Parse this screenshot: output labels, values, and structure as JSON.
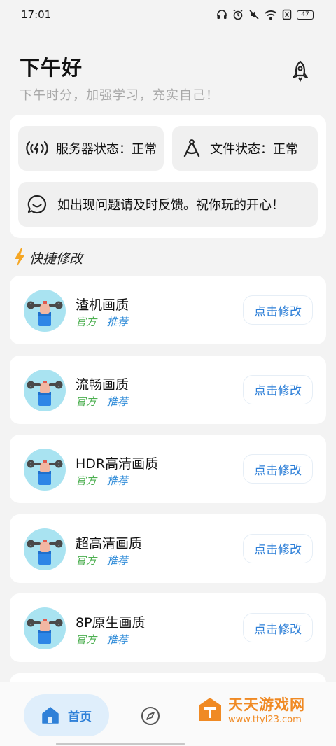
{
  "status_bar": {
    "time": "17:01",
    "battery": "47",
    "icons": [
      "headphones-icon",
      "alarm-icon",
      "mute-icon",
      "wifi-icon",
      "sim-icon",
      "battery-icon"
    ]
  },
  "header": {
    "greeting": "下午好",
    "subtitle": "下午时分，加强学习，充实自己！",
    "action_icon": "rocket-icon"
  },
  "status_card": {
    "server_status": "服务器状态：正常",
    "file_status": "文件状态：正常",
    "feedback_note": "如出现问题请及时反馈。祝你玩的开心！"
  },
  "section": {
    "title": "快捷修改",
    "icon": "lightning-icon"
  },
  "items": [
    {
      "name": "渣机画质",
      "tag_official": "官方",
      "tag_recommend": "推荐",
      "button": "点击修改"
    },
    {
      "name": "流畅画质",
      "tag_official": "官方",
      "tag_recommend": "推荐",
      "button": "点击修改"
    },
    {
      "name": "HDR高清画质",
      "tag_official": "官方",
      "tag_recommend": "推荐",
      "button": "点击修改"
    },
    {
      "name": "超高清画质",
      "tag_official": "官方",
      "tag_recommend": "推荐",
      "button": "点击修改"
    },
    {
      "name": "8P原生画质",
      "tag_official": "官方",
      "tag_recommend": "推荐",
      "button": "点击修改"
    }
  ],
  "bottom_nav": {
    "home_label": "首页",
    "home_icon": "home-icon",
    "discover_icon": "compass-icon"
  },
  "watermark": {
    "title": "天天游戏网",
    "url": "www.ttyl23.com"
  },
  "colors": {
    "accent": "#2f80d8",
    "official_tag": "#4caf50",
    "recommend_tag": "#2f8bd8",
    "avatar_bg": "#a9e3f1",
    "watermark": "#f08a24",
    "lightning": "#f5a623"
  }
}
